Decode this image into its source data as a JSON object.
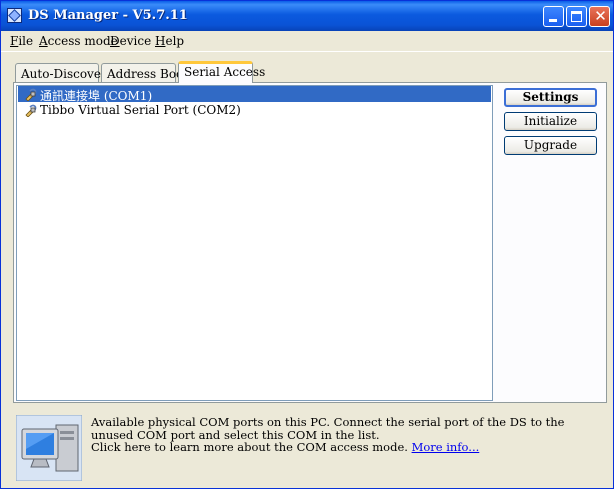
{
  "window": {
    "title": "DS Manager - V5.7.11"
  },
  "menu": [
    {
      "accel": "F",
      "rest": "ile"
    },
    {
      "accel": "A",
      "rest": "ccess mode"
    },
    {
      "accel": "D",
      "rest": "evice"
    },
    {
      "accel": "H",
      "rest": "elp"
    }
  ],
  "tabs": [
    {
      "label": "Auto-Discovery",
      "active": false
    },
    {
      "label": "Address Book",
      "active": false
    },
    {
      "label": "Serial Access",
      "active": true
    }
  ],
  "ports": [
    {
      "label": "通訊連接埠 (COM1)",
      "selected": true
    },
    {
      "label": "Tibbo Virtual Serial Port (COM2)",
      "selected": false
    }
  ],
  "buttons": {
    "settings": "Settings",
    "initialize": "Initialize",
    "upgrade": "Upgrade"
  },
  "status": {
    "line1": "Available physical COM ports on this PC. Connect the serial port of the DS to the unused COM port and select this COM in the list.",
    "line2": "Click here to learn more about the COM access mode.",
    "more_link": "More info..."
  },
  "icons": {
    "port": "serial-port-icon",
    "computer": "computer-icon"
  },
  "colors": {
    "selection": "#316ac5",
    "title_bar": "#0a5ee8",
    "active_tab_accent": "#ffc83c"
  }
}
